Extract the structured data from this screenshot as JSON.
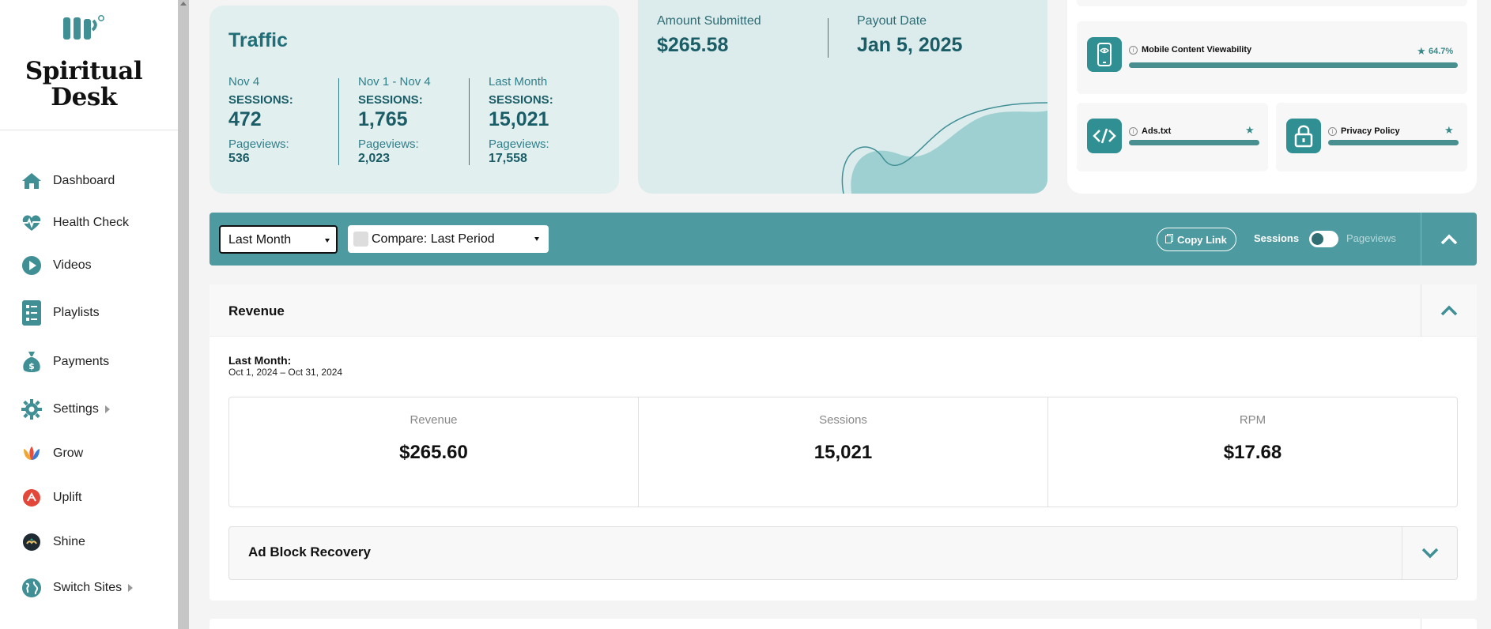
{
  "brand": {
    "name_line1": "Spiritual",
    "name_line2": "Desk"
  },
  "colors": {
    "accent": "#4d9aa0",
    "teal_dark": "#1a5d66",
    "card_bg": "#e2efef"
  },
  "nav": [
    {
      "label": "Dashboard",
      "icon": "home-icon"
    },
    {
      "label": "Health Check",
      "icon": "heartbeat-icon"
    },
    {
      "label": "Videos",
      "icon": "play-icon"
    },
    {
      "label": "Playlists",
      "icon": "checklist-icon"
    },
    {
      "label": "Payments",
      "icon": "money-bag-icon"
    },
    {
      "label": "Settings",
      "icon": "gear-icon"
    },
    {
      "label": "Grow",
      "icon": "grow-icon"
    },
    {
      "label": "Uplift",
      "icon": "uplift-icon"
    },
    {
      "label": "Shine",
      "icon": "shine-icon"
    },
    {
      "label": "Switch Sites",
      "icon": "globe-icon"
    }
  ],
  "traffic": {
    "title": "Traffic",
    "columns": [
      {
        "period": "Nov 4",
        "sessions_label": "SESSIONS:",
        "sessions": "472",
        "pageviews_label": "Pageviews:",
        "pageviews": "536"
      },
      {
        "period": "Nov 1 - Nov 4",
        "sessions_label": "SESSIONS:",
        "sessions": "1,765",
        "pageviews_label": "Pageviews:",
        "pageviews": "2,023"
      },
      {
        "period": "Last Month",
        "sessions_label": "SESSIONS:",
        "sessions": "15,021",
        "pageviews_label": "Pageviews:",
        "pageviews": "17,558"
      }
    ]
  },
  "payout": {
    "amount_label": "Amount Submitted",
    "amount": "$265.58",
    "date_label": "Payout Date",
    "date": "Jan 5, 2025"
  },
  "health_checks": [
    {
      "name": "Mobile Content Viewability",
      "icon": "mobile-eye-icon",
      "value": "64.7%",
      "fill": 1.0
    },
    {
      "name": "Ads.txt",
      "icon": "code-icon",
      "fill": 1.0
    },
    {
      "name": "Privacy Policy",
      "icon": "lock-icon",
      "fill": 1.0
    }
  ],
  "toolbar": {
    "period_value": "Last Month",
    "compare_value": "Compare: Last Period",
    "copy_link": "Copy Link",
    "toggle_left": "Sessions",
    "toggle_right": "Pageviews"
  },
  "revenue": {
    "title": "Revenue",
    "period_label": "Last Month:",
    "period_range": "Oct 1, 2024 – Oct 31, 2024",
    "stats": [
      {
        "label": "Revenue",
        "value": "$265.60"
      },
      {
        "label": "Sessions",
        "value": "15,021"
      },
      {
        "label": "RPM",
        "value": "$17.68"
      }
    ],
    "adblock_title": "Ad Block Recovery"
  }
}
